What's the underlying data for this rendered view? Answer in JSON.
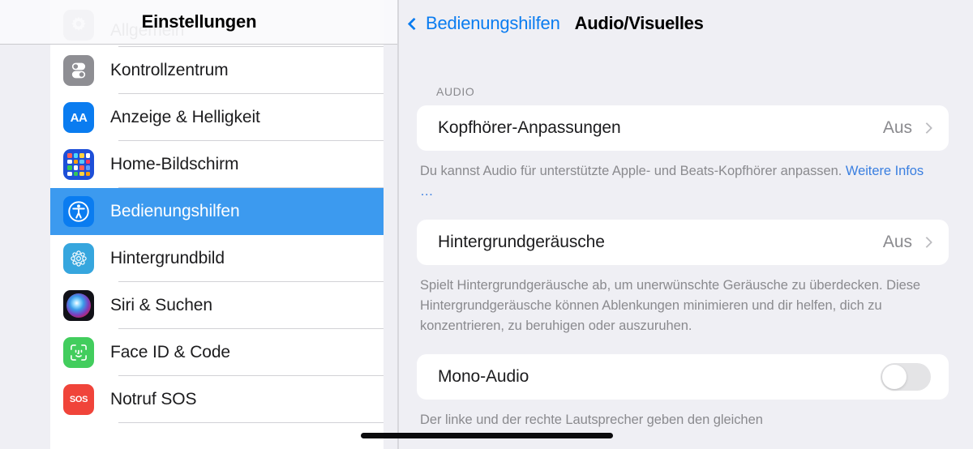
{
  "sidebar": {
    "title": "Einstellungen",
    "items": [
      {
        "label": "Allgemein",
        "icon": "gear-icon",
        "partial": true
      },
      {
        "label": "Kontrollzentrum",
        "icon": "control-center-icon"
      },
      {
        "label": "Anzeige & Helligkeit",
        "icon": "display-brightness-icon",
        "icon_text": "AA"
      },
      {
        "label": "Home-Bildschirm",
        "icon": "home-screen-icon"
      },
      {
        "label": "Bedienungshilfen",
        "icon": "accessibility-icon",
        "selected": true
      },
      {
        "label": "Hintergrundbild",
        "icon": "wallpaper-icon"
      },
      {
        "label": "Siri & Suchen",
        "icon": "siri-icon"
      },
      {
        "label": "Face ID & Code",
        "icon": "face-id-icon"
      },
      {
        "label": "Notruf SOS",
        "icon": "sos-icon",
        "icon_text": "SOS"
      }
    ]
  },
  "detail": {
    "back_label": "Bedienungshilfen",
    "back_icon": "chevron-left-icon",
    "title": "Audio/Visuelles",
    "section_audio": "AUDIO",
    "rows": {
      "headphone": {
        "label": "Kopfhörer-Anpassungen",
        "value": "Aus",
        "chevron": "chevron-right-icon"
      },
      "headphone_note_before": "Du kannst Audio für unterstützte Apple- und Beats-Kopfhörer anpassen. ",
      "headphone_note_link": "Weitere Infos …",
      "background_sounds": {
        "label": "Hintergrundgeräusche",
        "value": "Aus",
        "chevron": "chevron-right-icon"
      },
      "background_sounds_note": "Spielt Hintergrundgeräusche ab, um unerwünschte Geräusche zu überdecken. Diese Hintergrundgeräusche können Ablenkungen minimieren und dir helfen, dich zu konzentrieren, zu beruhigen oder auszuruhen.",
      "mono_audio": {
        "label": "Mono-Audio",
        "toggle_state": "off"
      },
      "mono_audio_note": "Der linke und der rechte Lautsprecher geben den gleichen"
    }
  },
  "colors": {
    "accent": "#0a7cf0",
    "selection": "#3c9aef",
    "background": "#efeff4",
    "card": "#ffffff",
    "secondary_text": "#8a8a8e",
    "link": "#3a7fe0"
  }
}
